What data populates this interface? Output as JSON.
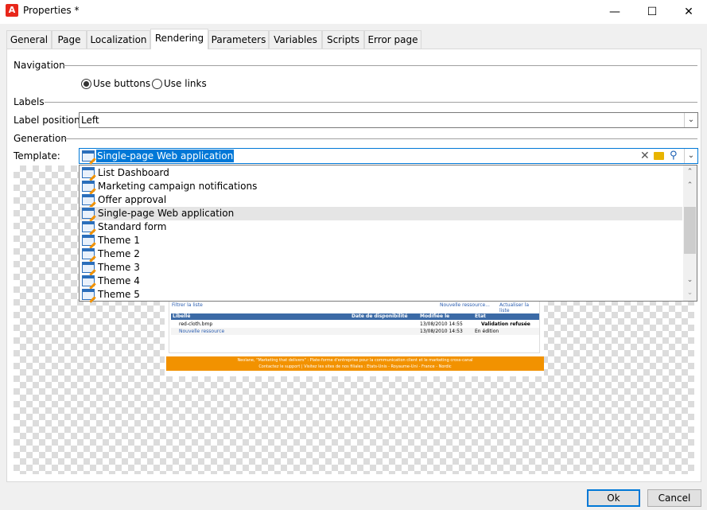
{
  "window": {
    "title": "Properties *",
    "minimize": "—",
    "maximize": "☐",
    "close": "✕"
  },
  "tabs": [
    "General",
    "Page",
    "Localization",
    "Rendering",
    "Parameters",
    "Variables",
    "Scripts",
    "Error page"
  ],
  "active_tab": "Rendering",
  "navigation": {
    "heading": "Navigation",
    "option_buttons": "Use buttons",
    "option_links": "Use links",
    "selected": "Use buttons"
  },
  "labels": {
    "heading": "Labels",
    "position_label": "Label position:",
    "position_value": "Left"
  },
  "generation": {
    "heading": "Generation",
    "template_label": "Template:",
    "template_value": "Single-page Web application"
  },
  "template_options": [
    "List Dashboard",
    "Marketing campaign notifications",
    "Offer approval",
    "Single-page Web application",
    "Standard form",
    "Theme 1",
    "Theme 2",
    "Theme 3",
    "Theme 4",
    "Theme 5"
  ],
  "preview": {
    "filter": "Filtrer la liste",
    "new_resource_link": "Nouvelle ressource...",
    "refresh": "Actualiser la liste",
    "headers": [
      "Libellé",
      "Date de disponibilité",
      "Modifiée le",
      "Etat"
    ],
    "rows": [
      {
        "name": "red-cloth.bmp",
        "date": "",
        "modified": "13/08/2010 14:55",
        "state": "Validation refusée"
      },
      {
        "name": "Nouvelle ressource",
        "date": "",
        "modified": "13/08/2010 14:53",
        "state": "En édition"
      }
    ],
    "footer_line1": "Neolane, \"Marketing that delivers\" : Plate-forme d'entreprise pour la communication client et le marketing cross-canal",
    "footer_line2": "Contactez le support | Visitez les sites de nos filiales : Etats-Unis - Royaume-Uni - France - Nordic"
  },
  "buttons": {
    "ok": "Ok",
    "cancel": "Cancel"
  }
}
